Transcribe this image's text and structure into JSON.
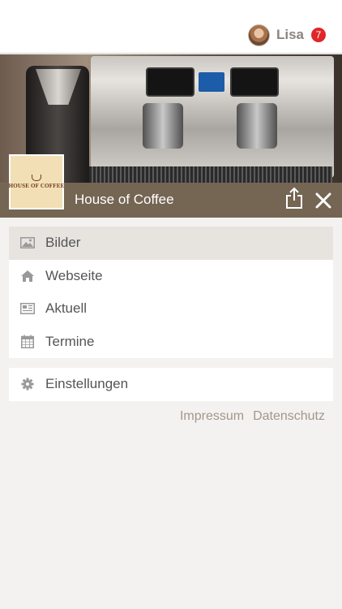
{
  "user": {
    "name": "Lisa",
    "notification_count": "7"
  },
  "brand": {
    "title": "House of Coffee",
    "logo_text": "HOUSE OF COFFEE"
  },
  "menu": {
    "items": [
      {
        "label": "Bilder",
        "icon": "image-icon",
        "active": true
      },
      {
        "label": "Webseite",
        "icon": "home-icon",
        "active": false
      },
      {
        "label": "Aktuell",
        "icon": "newspaper-icon",
        "active": false
      },
      {
        "label": "Termine",
        "icon": "calendar-icon",
        "active": false
      }
    ],
    "settings": {
      "label": "Einstellungen",
      "icon": "gear-icon"
    }
  },
  "footer": {
    "imprint": "Impressum",
    "privacy": "Datenschutz"
  },
  "colors": {
    "accent_bar": "#786855",
    "badge": "#e0262a",
    "active_item": "#e7e4e0",
    "footer_link": "#a4968a"
  }
}
